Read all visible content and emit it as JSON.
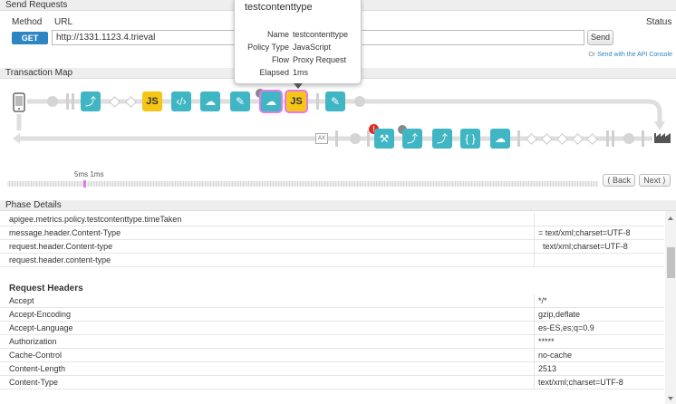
{
  "send_requests": {
    "section_title": "Send Requests",
    "method_label": "Method",
    "url_label": "URL",
    "status_label": "Status",
    "method_value": "GET",
    "url_value": "http://1331.1123.4.trieval",
    "send_label": "Send",
    "api_console_prefix": "Or",
    "api_console_link": "Send with the API Console"
  },
  "popup": {
    "title": "testcontenttype",
    "rows": [
      {
        "key": "Name",
        "value": "testcontenttype"
      },
      {
        "key": "Policy Type",
        "value": "JavaScript"
      },
      {
        "key": "Flow",
        "value": "Proxy Request"
      },
      {
        "key": "Elapsed",
        "value": "1ms"
      }
    ]
  },
  "transaction_map": {
    "section_title": "Transaction Map",
    "js_label": "JS",
    "ax_label": "AX",
    "alert_label": "!",
    "timeline_label": "5ms 1ms",
    "back_label": "⟨ Back",
    "next_label": "Next ⟩"
  },
  "phase_details": {
    "section_title": "Phase Details",
    "variables": [
      {
        "key": "apigee.metrics.policy.testcontenttype.timeTaken",
        "value": ""
      },
      {
        "key": "message.header.Content-Type",
        "value": "= text/xml;charset=UTF-8"
      },
      {
        "key": "request.header.Content-type",
        "value": "  text/xml;charset=UTF-8"
      },
      {
        "key": "request.header.content-type",
        "value": ""
      }
    ],
    "request_headers_title": "Request Headers",
    "headers": [
      {
        "key": "Accept",
        "value": "*/*"
      },
      {
        "key": "Accept-Encoding",
        "value": "gzip,deflate"
      },
      {
        "key": "Accept-Language",
        "value": "es-ES,es;q=0.9"
      },
      {
        "key": "Authorization",
        "value": "*****"
      },
      {
        "key": "Cache-Control",
        "value": "no-cache"
      },
      {
        "key": "Content-Length",
        "value": "2513"
      },
      {
        "key": "Content-Type",
        "value": "text/xml;charset=UTF-8"
      }
    ]
  },
  "colors": {
    "accent": "#2d86c3",
    "policy_tile": "#40b6c4",
    "js_tile": "#f5c518",
    "selection": "#e47be8",
    "error": "#e2291f"
  }
}
